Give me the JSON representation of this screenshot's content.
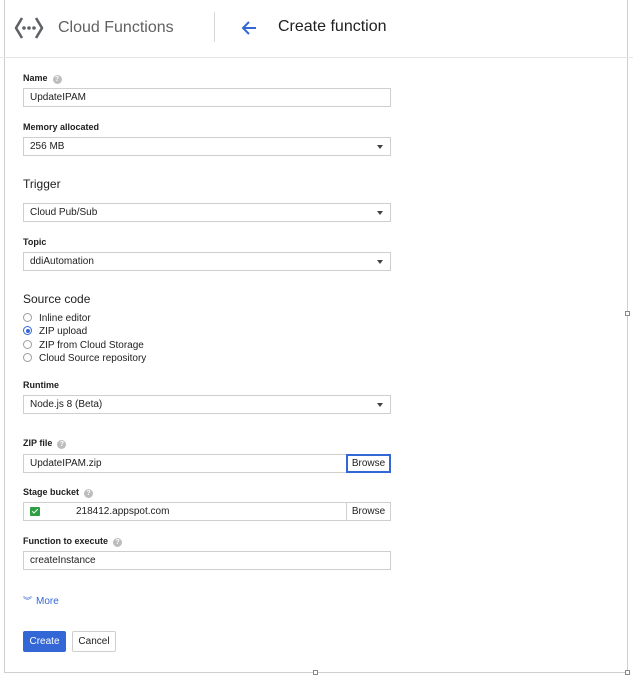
{
  "header": {
    "product_name": "Cloud Functions",
    "page_title": "Create function"
  },
  "form": {
    "name": {
      "label": "Name",
      "value": "UpdateIPAM"
    },
    "memory": {
      "label": "Memory allocated",
      "value": "256 MB"
    },
    "trigger": {
      "section": "Trigger",
      "value": "Cloud Pub/Sub"
    },
    "topic": {
      "label": "Topic",
      "value": "ddiAutomation"
    },
    "source": {
      "section": "Source code",
      "options": [
        "Inline editor",
        "ZIP upload",
        "ZIP from Cloud Storage",
        "Cloud Source repository"
      ],
      "selected": "ZIP upload"
    },
    "runtime": {
      "label": "Runtime",
      "value": "Node.js 8 (Beta)"
    },
    "zip_file": {
      "label": "ZIP file",
      "value": "UpdateIPAM.zip",
      "browse_label": "Browse"
    },
    "stage_bucket": {
      "label": "Stage bucket",
      "value": "218412.appspot.com",
      "browse_label": "Browse"
    },
    "function_to_execute": {
      "label": "Function to execute",
      "value": "createInstance"
    },
    "more_label": "More"
  },
  "actions": {
    "create_label": "Create",
    "cancel_label": "Cancel"
  },
  "colors": {
    "accent": "#3367d6",
    "bucket_icon": "#2e9e43"
  }
}
